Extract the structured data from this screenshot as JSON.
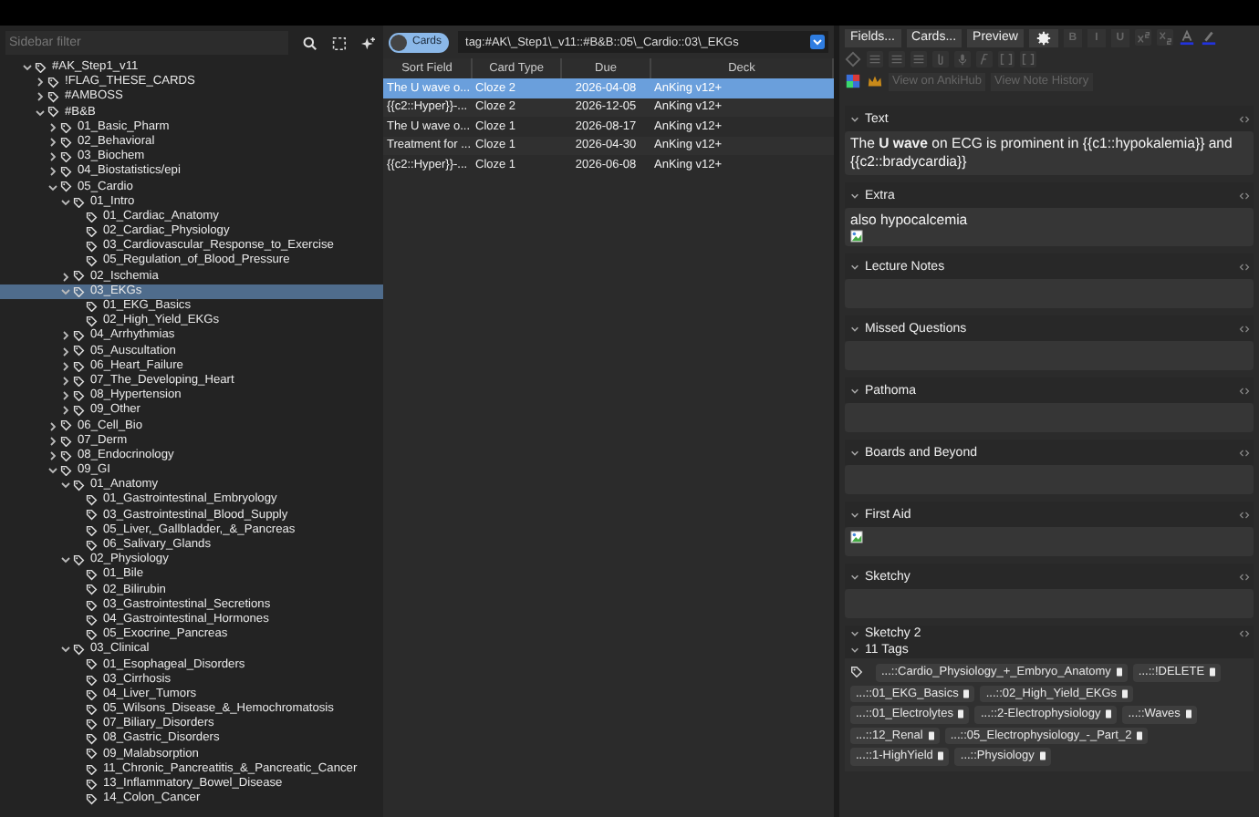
{
  "sidebar": {
    "filter": {
      "placeholder": "Sidebar filter"
    },
    "tree": [
      {
        "label": "#AK_Step1_v11",
        "expanded": true,
        "selected": false,
        "children": [
          {
            "label": "!FLAG_THESE_CARDS",
            "expanded": false,
            "selected": false
          },
          {
            "label": "#AMBOSS",
            "expanded": false,
            "selected": false
          },
          {
            "label": "#B&B",
            "expanded": true,
            "selected": false,
            "children": [
              {
                "label": "01_Basic_Pharm",
                "expanded": false,
                "selected": false
              },
              {
                "label": "02_Behavioral",
                "expanded": false,
                "selected": false
              },
              {
                "label": "03_Biochem",
                "expanded": false,
                "selected": false
              },
              {
                "label": "04_Biostatistics/epi",
                "expanded": false,
                "selected": false
              },
              {
                "label": "05_Cardio",
                "expanded": true,
                "selected": false,
                "children": [
                  {
                    "label": "01_Intro",
                    "expanded": true,
                    "selected": false,
                    "children": [
                      {
                        "label": "01_Cardiac_Anatomy",
                        "selected": false
                      },
                      {
                        "label": "02_Cardiac_Physiology",
                        "selected": false
                      },
                      {
                        "label": "03_Cardiovascular_Response_to_Exercise",
                        "selected": false
                      },
                      {
                        "label": "05_Regulation_of_Blood_Pressure",
                        "selected": false
                      }
                    ]
                  },
                  {
                    "label": "02_Ischemia",
                    "expanded": false,
                    "selected": false
                  },
                  {
                    "label": "03_EKGs",
                    "expanded": true,
                    "selected": true,
                    "children": [
                      {
                        "label": "01_EKG_Basics",
                        "selected": false
                      },
                      {
                        "label": "02_High_Yield_EKGs",
                        "selected": false
                      }
                    ]
                  },
                  {
                    "label": "04_Arrhythmias",
                    "expanded": false,
                    "selected": false
                  },
                  {
                    "label": "05_Auscultation",
                    "expanded": false,
                    "selected": false
                  },
                  {
                    "label": "06_Heart_Failure",
                    "expanded": false,
                    "selected": false
                  },
                  {
                    "label": "07_The_Developing_Heart",
                    "expanded": false,
                    "selected": false
                  },
                  {
                    "label": "08_Hypertension",
                    "expanded": false,
                    "selected": false
                  },
                  {
                    "label": "09_Other",
                    "expanded": false,
                    "selected": false
                  }
                ]
              },
              {
                "label": "06_Cell_Bio",
                "expanded": false,
                "selected": false
              },
              {
                "label": "07_Derm",
                "expanded": false,
                "selected": false
              },
              {
                "label": "08_Endocrinology",
                "expanded": false,
                "selected": false
              },
              {
                "label": "09_GI",
                "expanded": true,
                "selected": false,
                "children": [
                  {
                    "label": "01_Anatomy",
                    "expanded": true,
                    "selected": false,
                    "children": [
                      {
                        "label": "01_Gastrointestinal_Embryology",
                        "selected": false
                      },
                      {
                        "label": "03_Gastrointestinal_Blood_Supply",
                        "selected": false
                      },
                      {
                        "label": "05_Liver,_Gallbladder,_&_Pancreas",
                        "selected": false
                      },
                      {
                        "label": "06_Salivary_Glands",
                        "selected": false
                      }
                    ]
                  },
                  {
                    "label": "02_Physiology",
                    "expanded": true,
                    "selected": false,
                    "children": [
                      {
                        "label": "01_Bile",
                        "selected": false
                      },
                      {
                        "label": "02_Bilirubin",
                        "selected": false
                      },
                      {
                        "label": "03_Gastrointestinal_Secretions",
                        "selected": false
                      },
                      {
                        "label": "04_Gastrointestinal_Hormones",
                        "selected": false
                      },
                      {
                        "label": "05_Exocrine_Pancreas",
                        "selected": false
                      }
                    ]
                  },
                  {
                    "label": "03_Clinical",
                    "expanded": true,
                    "selected": false,
                    "children": [
                      {
                        "label": "01_Esophageal_Disorders",
                        "selected": false
                      },
                      {
                        "label": "03_Cirrhosis",
                        "selected": false
                      },
                      {
                        "label": "04_Liver_Tumors",
                        "selected": false
                      },
                      {
                        "label": "05_Wilsons_Disease_&_Hemochromatosis",
                        "selected": false
                      },
                      {
                        "label": "07_Biliary_Disorders",
                        "selected": false
                      },
                      {
                        "label": "08_Gastric_Disorders",
                        "selected": false
                      },
                      {
                        "label": "09_Malabsorption",
                        "selected": false
                      },
                      {
                        "label": "11_Chronic_Pancreatitis_&_Pancreatic_Cancer",
                        "selected": false
                      },
                      {
                        "label": "13_Inflammatory_Bowel_Disease",
                        "selected": false
                      },
                      {
                        "label": "14_Colon_Cancer",
                        "selected": false
                      }
                    ]
                  }
                ]
              }
            ]
          }
        ]
      }
    ]
  },
  "browser": {
    "toggle": {
      "label": "Cards"
    },
    "search": {
      "value": "tag:#AK\\_Step1\\_v11::#B&B::05\\_Cardio::03\\_EKGs"
    },
    "table": {
      "columns": [
        "Sort Field",
        "Card Type",
        "Due",
        "Deck"
      ],
      "rows": [
        {
          "cells": [
            "The U wave o...",
            "Cloze 2",
            "2026-04-08",
            "AnKing v12+"
          ],
          "selected": true
        },
        {
          "cells": [
            "{{c2::Hyper}}-...",
            "Cloze 2",
            "2026-12-05",
            "AnKing v12+"
          ],
          "selected": false
        },
        {
          "cells": [
            "The U wave o...",
            "Cloze 1",
            "2026-08-17",
            "AnKing v12+"
          ],
          "selected": false
        },
        {
          "cells": [
            "Treatment for ...",
            "Cloze 1",
            "2026-04-30",
            "AnKing v12+"
          ],
          "selected": false
        },
        {
          "cells": [
            "{{c2::Hyper}}-...",
            "Cloze 1",
            "2026-06-08",
            "AnKing v12+"
          ],
          "selected": false
        }
      ]
    }
  },
  "editor": {
    "buttons": [
      "Fields...",
      "Cards...",
      "Preview"
    ],
    "format_buttons": [
      {
        "label": "B",
        "disabled": true
      },
      {
        "label": "I",
        "disabled": true
      },
      {
        "label": "U",
        "disabled": true
      }
    ],
    "link_buttons": [
      {
        "label": "View on AnkiHub",
        "disabled": true
      },
      {
        "label": "View Note History",
        "disabled": true
      }
    ],
    "fields": [
      {
        "name": "Text",
        "content": "The **U wave** on ECG is prominent in {{c1::hypokalemia}} and {{c2::bradycardia}}"
      },
      {
        "name": "Extra",
        "content": "also hypocalcemia",
        "image": true
      },
      {
        "name": "Lecture Notes"
      },
      {
        "name": "Missed Questions"
      },
      {
        "name": "Pathoma"
      },
      {
        "name": "Boards and Beyond"
      },
      {
        "name": "First Aid",
        "image": true
      },
      {
        "name": "Sketchy"
      }
    ],
    "cut_field": "Sketchy 2",
    "tags": {
      "title": "11 Tags",
      "items": [
        "...::Cardio_Physiology_+_Embryo_Anatomy",
        "...::!DELETE",
        "...::01_EKG_Basics",
        "...::02_High_Yield_EKGs",
        "...::01_Electrolytes",
        "...::2-Electrophysiology",
        "...::Waves",
        "...::12_Renal",
        "...::05_Electrophysiology_-_Part_2",
        "...::1-HighYield",
        "...::Physiology"
      ]
    }
  }
}
